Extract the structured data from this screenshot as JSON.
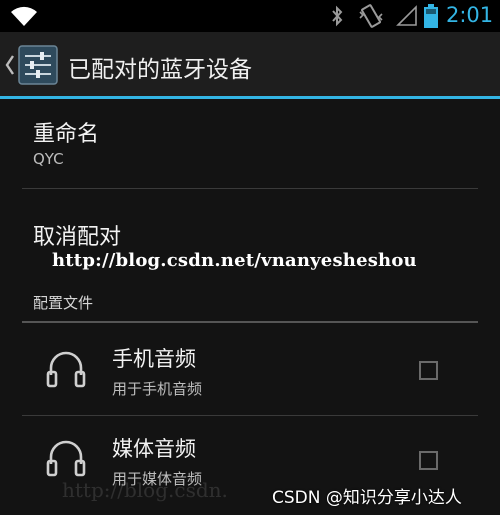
{
  "status_bar": {
    "time": "2:01",
    "accent_color": "#33b5e5",
    "icons": [
      "wifi-icon",
      "bluetooth-icon",
      "vibrate-icon",
      "signal-icon",
      "battery-icon"
    ]
  },
  "action_bar": {
    "title": "已配对的蓝牙设备",
    "icon": "settings-sliders-icon",
    "back_icon": "chevron-left-icon"
  },
  "rename": {
    "title": "重命名",
    "value": "QYC"
  },
  "unpair": {
    "title": "取消配对"
  },
  "overlay_url": "http://blog.csdn.net/vnanyesheshou",
  "profiles": {
    "header": "配置文件",
    "items": [
      {
        "name": "手机音频",
        "description": "用于手机音频",
        "icon": "headphones-icon",
        "checked": false
      },
      {
        "name": "媒体音频",
        "description": "用于媒体音频",
        "icon": "headphones-icon",
        "checked": false
      }
    ]
  },
  "watermarks": {
    "faint": "http://blog.csdn.",
    "csdn": "CSDN @知识分享小达人"
  }
}
